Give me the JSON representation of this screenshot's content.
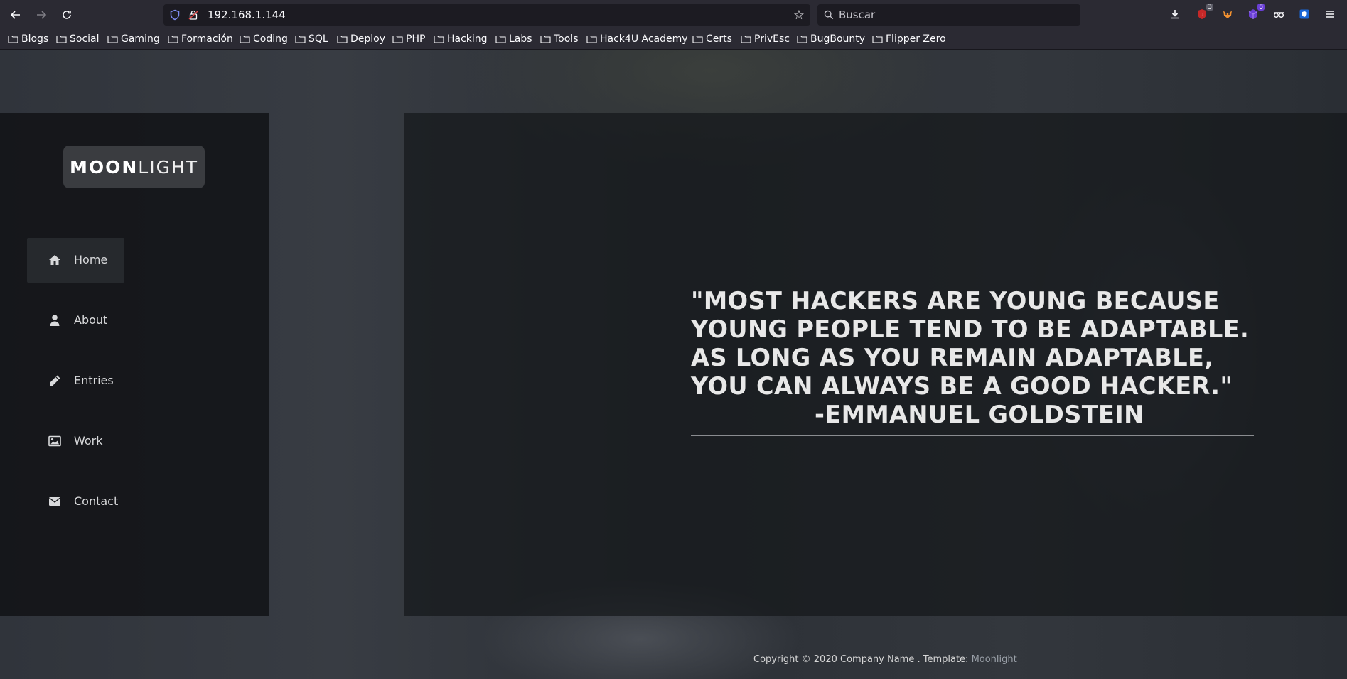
{
  "browser": {
    "url": "192.168.1.144",
    "search_placeholder": "Buscar",
    "extension_badges": {
      "ublock": "3",
      "proxy": "8"
    },
    "bookmarks": [
      "Blogs",
      "Social",
      "Gaming",
      "Formación",
      "Coding",
      "SQL",
      "Deploy",
      "PHP",
      "Hacking",
      "Labs",
      "Tools",
      "Hack4U Academy",
      "Certs",
      "PrivEsc",
      "BugBounty",
      "Flipper Zero"
    ]
  },
  "site": {
    "logo_bold": "MOON",
    "logo_light": "LIGHT",
    "menu": [
      {
        "label": "Home",
        "icon": "home-icon",
        "active": true
      },
      {
        "label": "About",
        "icon": "user-icon",
        "active": false
      },
      {
        "label": "Entries",
        "icon": "pencil-icon",
        "active": false
      },
      {
        "label": "Work",
        "icon": "image-icon",
        "active": false
      },
      {
        "label": "Contact",
        "icon": "envelope-icon",
        "active": false
      }
    ],
    "quote": "\"MOST HACKERS ARE YOUNG BECAUSE YOUNG PEOPLE TEND TO BE ADAPTABLE. AS LONG AS YOU REMAIN ADAPTABLE, YOU CAN ALWAYS BE A GOOD HACKER.\"",
    "quote_author": "-EMMANUEL GOLDSTEIN",
    "footer_text": "Copyright © 2020 Company Name . Template: ",
    "footer_link": "Moonlight"
  },
  "colors": {
    "browser_chrome": "#2b2a33",
    "urlbar_bg": "#1c1b22",
    "sidebar_bg": "#111316",
    "logo_bg": "#3a3c40",
    "quote_text": "#e8e8e8",
    "ublock_red": "#c62828",
    "proxy_purple": "#6a3fd6"
  }
}
